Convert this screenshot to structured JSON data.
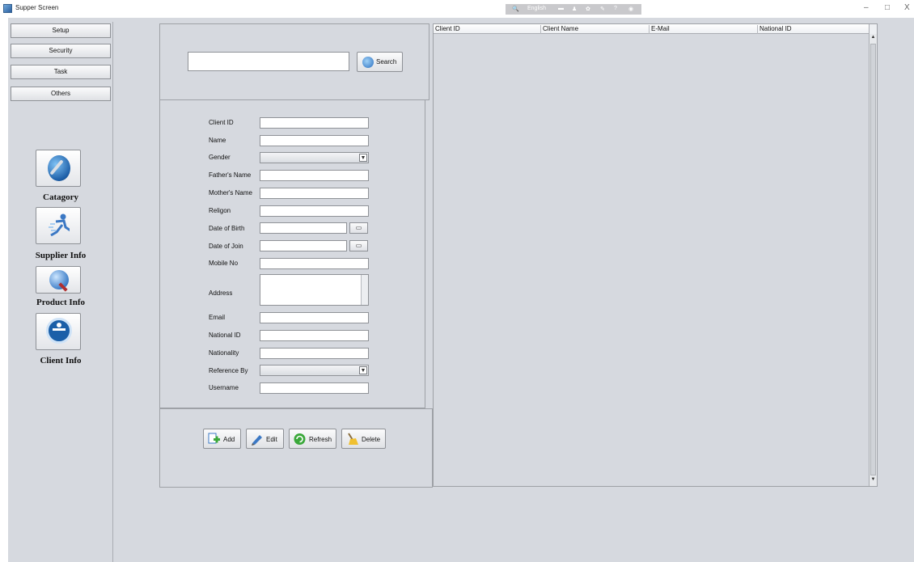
{
  "window": {
    "title": "Supper Screen",
    "ime_lang": "English",
    "minimize": "–",
    "maximize": "□",
    "close": "X"
  },
  "sidebar": {
    "nav": [
      "Setup",
      "Security",
      "Task",
      "Others"
    ],
    "tiles": [
      {
        "label": "Catagory",
        "icon": "wrench-globe-icon"
      },
      {
        "label": "Supplier Info",
        "icon": "runner-icon"
      },
      {
        "label": "Product Info",
        "icon": "magnifier-icon"
      },
      {
        "label": "Client Info",
        "icon": "accessibility-icon"
      }
    ]
  },
  "search": {
    "value": "",
    "button": "Search"
  },
  "form": {
    "labels": {
      "client_id": "Client ID",
      "name": "Name",
      "gender": "Gender",
      "father": "Father's Name",
      "mother": "Mother's Name",
      "religion": "Religon",
      "dob": "Date of Birth",
      "doj": "Date of Join",
      "mobile": "Mobile No",
      "address": "Address",
      "email": "Email",
      "national_id": "National ID",
      "nationality": "Nationality",
      "reference": "Reference By",
      "username": "Username"
    },
    "values": {
      "client_id": "",
      "name": "",
      "gender": "",
      "father": "",
      "mother": "",
      "religion": "",
      "dob": "",
      "doj": "",
      "mobile": "",
      "address": "",
      "email": "",
      "national_id": "",
      "nationality": "",
      "reference": "",
      "username": ""
    },
    "combo_arrow": "▼",
    "date_btn": "▭"
  },
  "actions": {
    "add": "Add",
    "edit": "Edit",
    "refresh": "Refresh",
    "delete": "Delete"
  },
  "table": {
    "columns": [
      "Client ID",
      "Client Name",
      "E-Mail",
      "National ID"
    ],
    "rows": []
  }
}
